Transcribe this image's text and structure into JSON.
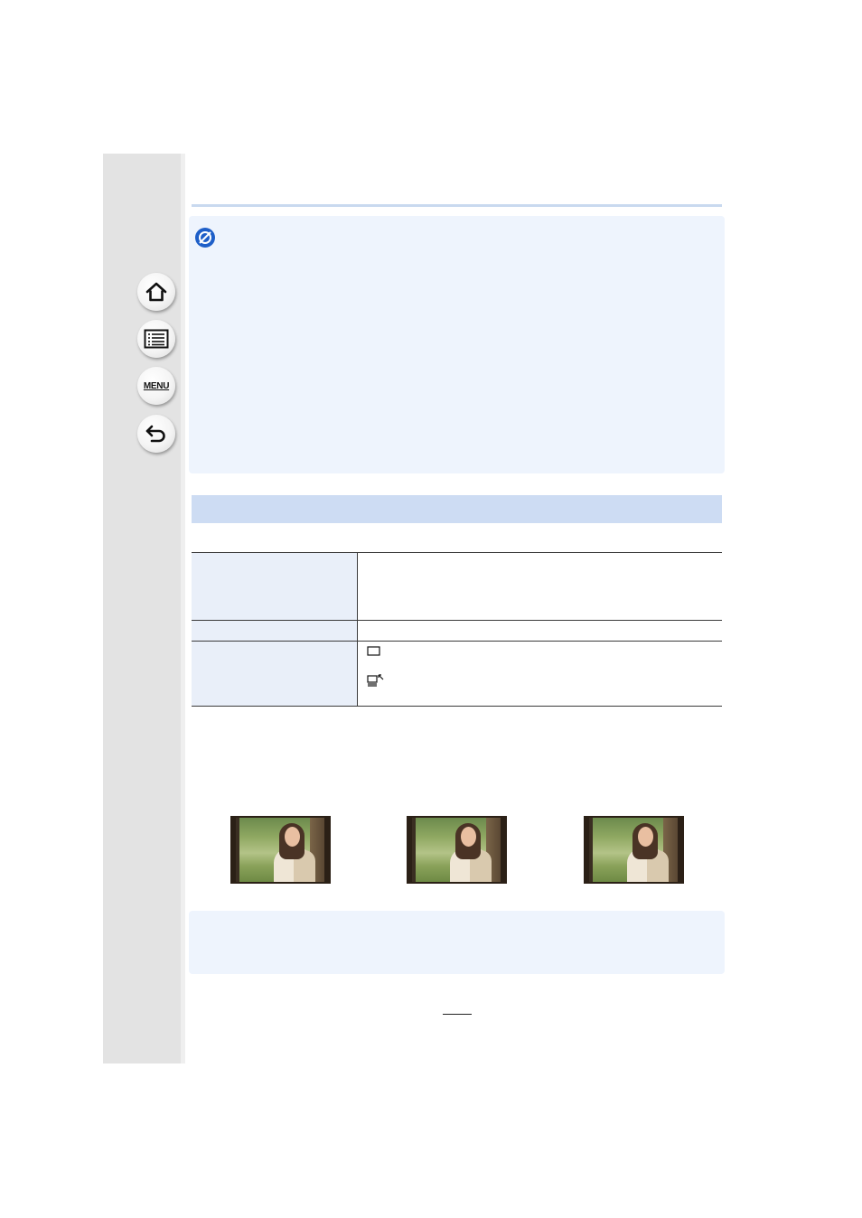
{
  "nav": {
    "home": {
      "icon": "home-icon"
    },
    "contents": {
      "icon": "list-icon"
    },
    "menu": {
      "label": "MENU"
    },
    "back": {
      "icon": "back-arrow-icon"
    }
  },
  "note": {
    "icon": "prohibited-icon",
    "text": ""
  },
  "section": {
    "title": ""
  },
  "settings_table": {
    "rows": [
      {
        "label": "",
        "value": ""
      },
      {
        "label": "",
        "value": ""
      },
      {
        "label": "",
        "options": [
          {
            "icon": "single-frame-icon",
            "text": ""
          },
          {
            "icon": "burst-mode-icon",
            "text": ""
          }
        ]
      }
    ]
  },
  "examples": {
    "images": [
      {
        "caption": ""
      },
      {
        "caption": ""
      },
      {
        "caption": ""
      }
    ]
  },
  "bottom_note": {
    "text": ""
  },
  "page": {
    "number": ""
  },
  "colors": {
    "sidebar": "#e3e3e3",
    "note_background": "#eef4fd",
    "section_bar": "#cddcf3",
    "table_label_cell": "#e9eff9",
    "accent_blue": "#1e5fc8"
  }
}
